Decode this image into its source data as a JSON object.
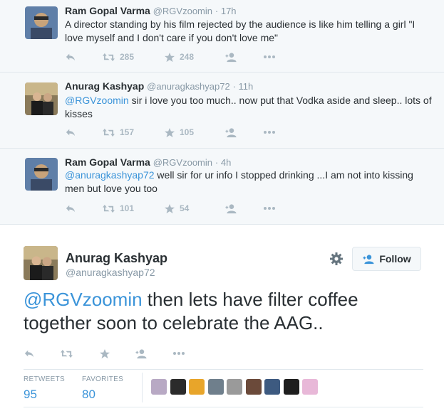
{
  "thread": [
    {
      "name": "Ram Gopal Varma",
      "handle": "@RGVzoomin",
      "time": "17h",
      "text_parts": {
        "mention": "",
        "body": "A director standing by his film rejected by the audience is like him telling a girl \"I love myself and I don't care if you don't love me\""
      },
      "retweets": "285",
      "favorites": "248"
    },
    {
      "name": "Anurag Kashyap",
      "handle": "@anuragkashyap72",
      "time": "11h",
      "text_parts": {
        "mention": "@RGVzoomin",
        "body": " sir i love you too much.. now put that Vodka aside and sleep.. lots of kisses"
      },
      "retweets": "157",
      "favorites": "105"
    },
    {
      "name": "Ram Gopal Varma",
      "handle": "@RGVzoomin",
      "time": "4h",
      "text_parts": {
        "mention": "@anuragkashyap72",
        "body": " well sir for ur info I stopped drinking ...I am not into kissing men but love you too"
      },
      "retweets": "101",
      "favorites": "54"
    }
  ],
  "main_tweet": {
    "name": "Anurag Kashyap",
    "handle": "@anuragkashyap72",
    "follow_label": "Follow",
    "mention": "@RGVzoomin",
    "body": " then lets have filter coffee together soon to celebrate the AAG..",
    "stats": {
      "retweets_label": "RETWEETS",
      "retweets": "95",
      "favorites_label": "FAVORITES",
      "favorites": "80"
    }
  },
  "icons": [
    "reply-icon",
    "retweet-icon",
    "favorite-icon",
    "follow-user-icon",
    "more-icon",
    "gear-icon"
  ],
  "colors": {
    "link": "#3b94d9",
    "muted": "#8899a6",
    "icon": "#aab8c2",
    "background": "#f5f8fa",
    "text": "#292f33"
  },
  "favoriter_avatar_colors": [
    "#b8a9c4",
    "#2b2b2b",
    "#e8a52a",
    "#6f7f8c",
    "#9a9a9a",
    "#6b4a3a",
    "#3d5a80",
    "#1e1e1e",
    "#e8b8d8"
  ]
}
